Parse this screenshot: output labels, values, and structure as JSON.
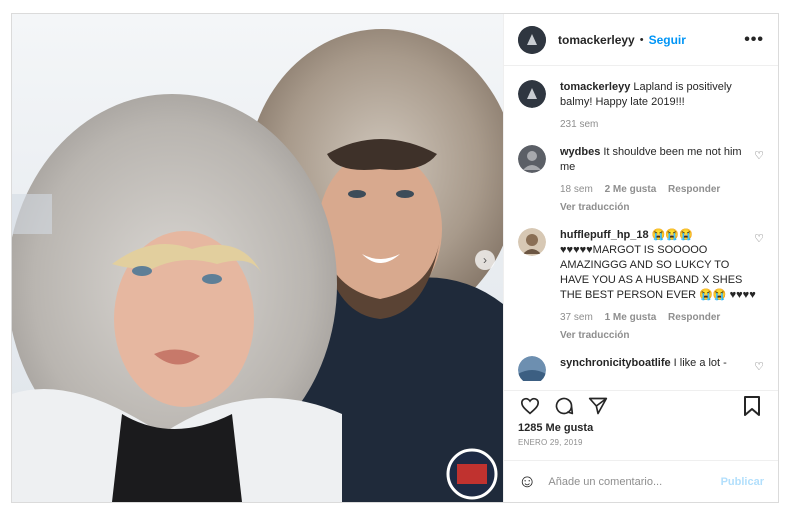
{
  "post": {
    "username": "tomackerleyy",
    "follow_label": "Seguir",
    "more_label": "•••",
    "caption_user": "tomackerleyy",
    "caption_text": "Lapland is positively balmy! Happy late 2019!!!",
    "caption_time": "231 sem"
  },
  "comments": [
    {
      "user": "wydbes",
      "text": "It shouldve been me not him me",
      "time": "18 sem",
      "likes": "2 Me gusta",
      "reply": "Responder",
      "translate": "Ver traducción"
    },
    {
      "user": "hufflepuff_hp_18",
      "text": "😭😭😭 ♥♥♥♥♥MARGOT IS SOOOOO AMAZINGGG AND SO LUKCY TO HAVE YOU AS A HUSBAND X SHES THE BEST PERSON EVER 😭😭 ♥♥♥♥",
      "time": "37 sem",
      "likes": "1 Me gusta",
      "reply": "Responder",
      "translate": "Ver traducción"
    },
    {
      "user": "synchronicityboatlife",
      "text": "I like a lot -"
    }
  ],
  "footer": {
    "likes_count": "1285 Me gusta",
    "date": "ENERO 29, 2019",
    "comment_placeholder": "Añade un comentario...",
    "publish_label": "Publicar"
  },
  "colors": {
    "link_blue": "#0095f6",
    "publish_disabled": "#b2dffc"
  }
}
